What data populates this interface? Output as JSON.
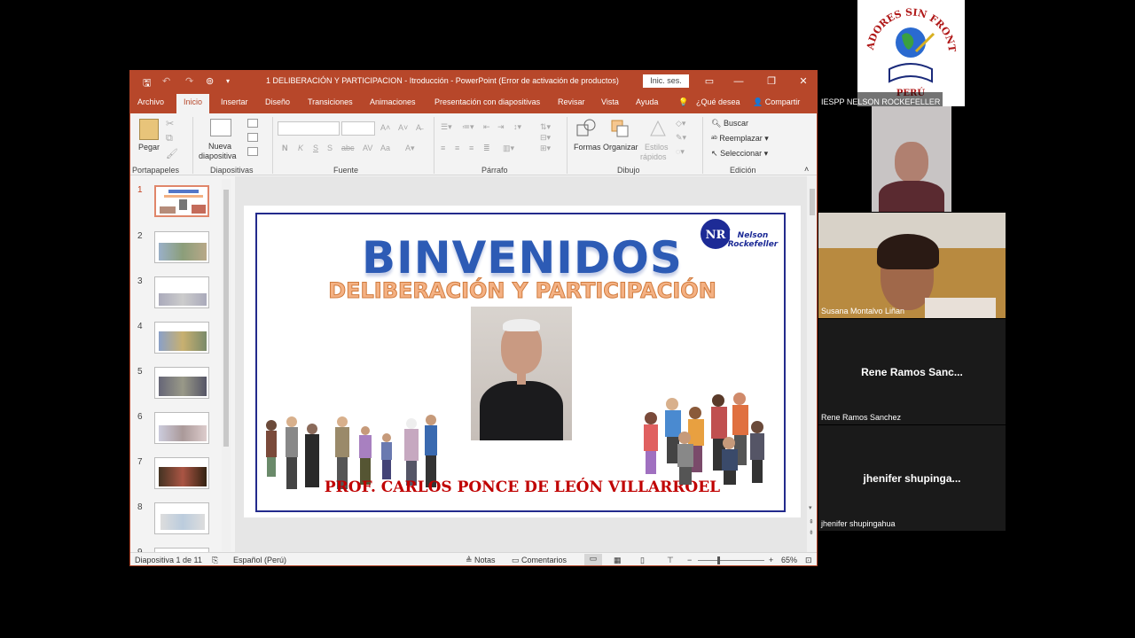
{
  "window": {
    "title": "1 DELIBERACIÓN Y PARTICIPACION - Itroducción  -  PowerPoint (Error de activación de productos)",
    "signin_label": "Inic. ses.",
    "controls": [
      "▭",
      "—",
      "❐",
      "✕"
    ]
  },
  "tabs": [
    "Archivo",
    "Inicio",
    "Insertar",
    "Diseño",
    "Transiciones",
    "Animaciones",
    "Presentación con diapositivas",
    "Revisar",
    "Vista",
    "Ayuda",
    "¿Qué desea",
    "Compartir"
  ],
  "active_tab": "Inicio",
  "ribbon": {
    "clipboard": {
      "paste": "Pegar",
      "label": "Portapapeles"
    },
    "slides": {
      "new_slide_1": "Nueva",
      "new_slide_2": "diapositiva",
      "label": "Diapositivas"
    },
    "font": {
      "label": "Fuente",
      "buttons": [
        "N",
        "K",
        "S",
        "S",
        "abc",
        "AV",
        "Aa"
      ]
    },
    "paragraph": {
      "label": "Párrafo"
    },
    "drawing": {
      "shapes": "Formas",
      "arrange": "Organizar",
      "quick_styles_1": "Estilos",
      "quick_styles_2": "rápidos",
      "label": "Dibujo"
    },
    "editing": {
      "find": "Buscar",
      "replace": "Reemplazar",
      "select": "Seleccionar",
      "label": "Edición"
    }
  },
  "thumbnails": [
    "1",
    "2",
    "3",
    "4",
    "5",
    "6",
    "7",
    "8",
    "9"
  ],
  "slide": {
    "title": "BINVENIDOS",
    "subtitle": "DELIBERACIÓN Y PARTICIPACIÓN",
    "author": "PROF. CARLOS PONCE DE LEÓN VILLARROEL",
    "logo_text_1": "Nelson",
    "logo_text_2": "Rockefeller",
    "logo_mark": "NR"
  },
  "status": {
    "slide_count": "Diapositiva 1 de 11",
    "language": "Español (Perú)",
    "notes": "Notas",
    "comments": "Comentarios",
    "zoom": "65%"
  },
  "participants": {
    "host_label": "IESPP NELSON ROCKEFELLER",
    "logo_text_1": "EDUCADORES SIN FRONTERAS",
    "logo_text_2": "PERÚ",
    "p2": "Susana Montalvo Liñan",
    "p3_big": "Rene Ramos Sanc...",
    "p3": "Rene Ramos Sanchez",
    "p4_big": "jhenifer shupinga...",
    "p4": "jhenifer shupingahua"
  },
  "colors": {
    "ppt_accent": "#b7472a",
    "slide_frame": "#232a8c",
    "title_blue": "#2d5bb5",
    "subtitle_orange": "#f4b183",
    "author_red": "#c00000"
  }
}
